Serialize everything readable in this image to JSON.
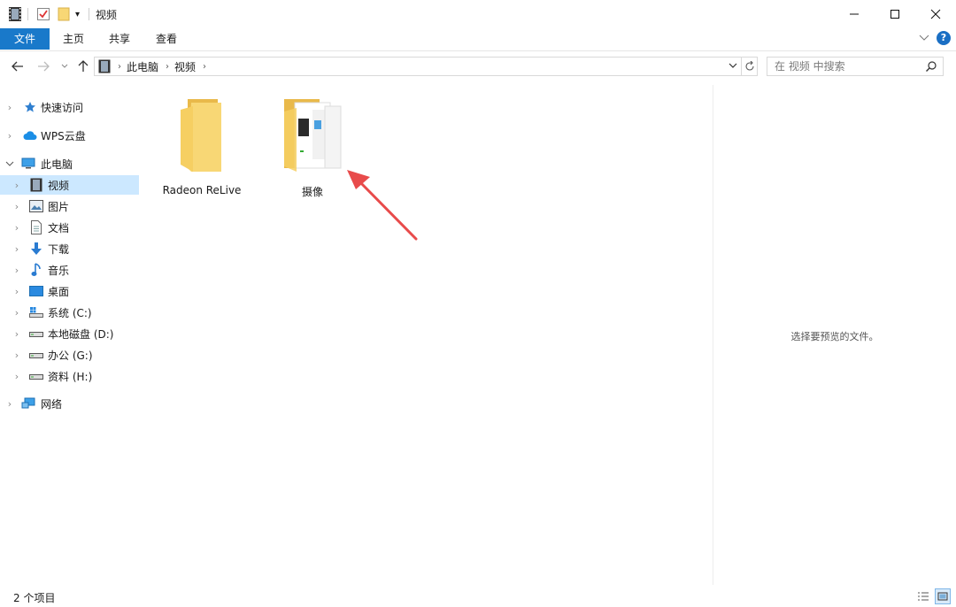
{
  "titlebar": {
    "title": "视频",
    "controls": {
      "minimize": "—",
      "maximize": "☐",
      "close": "✕"
    }
  },
  "ribbon": {
    "tabs": [
      "文件",
      "主页",
      "共享",
      "查看"
    ],
    "help": "?"
  },
  "address": {
    "breadcrumbs": [
      "此电脑",
      "视频"
    ],
    "search_placeholder": "在 视频 中搜索"
  },
  "nav": {
    "items": [
      {
        "label": "快速访问",
        "icon": "star-icon"
      },
      {
        "label": "WPS云盘",
        "icon": "cloud-icon"
      },
      {
        "label": "此电脑",
        "icon": "computer-icon"
      },
      {
        "label": "视频",
        "icon": "video-icon",
        "selected": true
      },
      {
        "label": "图片",
        "icon": "picture-icon"
      },
      {
        "label": "文档",
        "icon": "document-icon"
      },
      {
        "label": "下载",
        "icon": "download-icon"
      },
      {
        "label": "音乐",
        "icon": "music-icon"
      },
      {
        "label": "桌面",
        "icon": "desktop-icon"
      },
      {
        "label": "系统 (C:)",
        "icon": "system-drive-icon"
      },
      {
        "label": "本地磁盘 (D:)",
        "icon": "drive-icon"
      },
      {
        "label": "办公 (G:)",
        "icon": "drive-icon"
      },
      {
        "label": "资料 (H:)",
        "icon": "drive-icon"
      },
      {
        "label": "网络",
        "icon": "network-icon"
      }
    ]
  },
  "files": [
    {
      "name": "Radeon ReLive",
      "icon": "folder-icon"
    },
    {
      "name": "摄像",
      "icon": "folder-with-content-icon"
    }
  ],
  "preview": {
    "message": "选择要预览的文件。"
  },
  "status": {
    "count": "2 个项目"
  },
  "colors": {
    "accent": "#1979ca",
    "selection": "#cce8ff",
    "folder": "#f8d775",
    "annotation_arrow": "#e84b4b"
  }
}
